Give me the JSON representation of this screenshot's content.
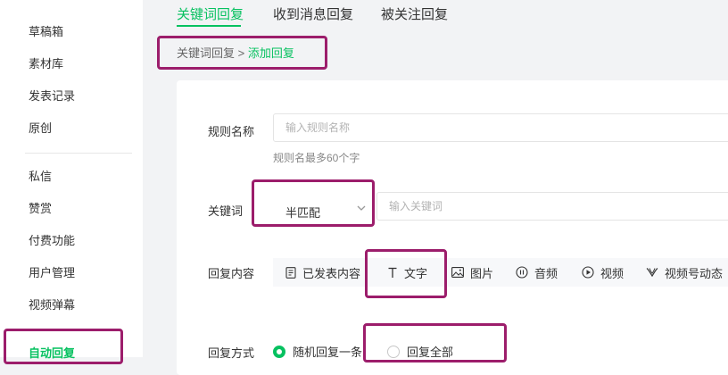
{
  "sidebar": {
    "items": [
      {
        "label": "草稿箱"
      },
      {
        "label": "素材库"
      },
      {
        "label": "发表记录"
      },
      {
        "label": "原创"
      },
      {
        "label": "私信"
      },
      {
        "label": "赞赏"
      },
      {
        "label": "付费功能"
      },
      {
        "label": "用户管理"
      },
      {
        "label": "视频弹幕"
      },
      {
        "label": "自动回复"
      }
    ]
  },
  "tabs": [
    {
      "label": "关键词回复"
    },
    {
      "label": "收到消息回复"
    },
    {
      "label": "被关注回复"
    }
  ],
  "breadcrumb": {
    "parent": "关键词回复",
    "separator": " > ",
    "current": "添加回复"
  },
  "form": {
    "rule_name": {
      "label": "规则名称",
      "placeholder": "输入规则名称",
      "hint": "规则名最多60个字"
    },
    "keyword": {
      "label": "关键词",
      "match_mode": "半匹配",
      "placeholder": "输入关键词"
    },
    "reply_content": {
      "label": "回复内容",
      "types": [
        {
          "label": "已发表内容",
          "icon": "document-icon"
        },
        {
          "label": "文字",
          "icon": "text-icon"
        },
        {
          "label": "图片",
          "icon": "image-icon"
        },
        {
          "label": "音频",
          "icon": "audio-icon"
        },
        {
          "label": "视频",
          "icon": "video-icon"
        },
        {
          "label": "视频号动态",
          "icon": "channels-icon"
        }
      ]
    },
    "reply_mode": {
      "label": "回复方式",
      "options": [
        {
          "label": "随机回复一条",
          "selected": true
        },
        {
          "label": "回复全部",
          "selected": false
        }
      ]
    }
  },
  "colors": {
    "accent": "#07c160",
    "highlight": "#9c1d6b"
  }
}
